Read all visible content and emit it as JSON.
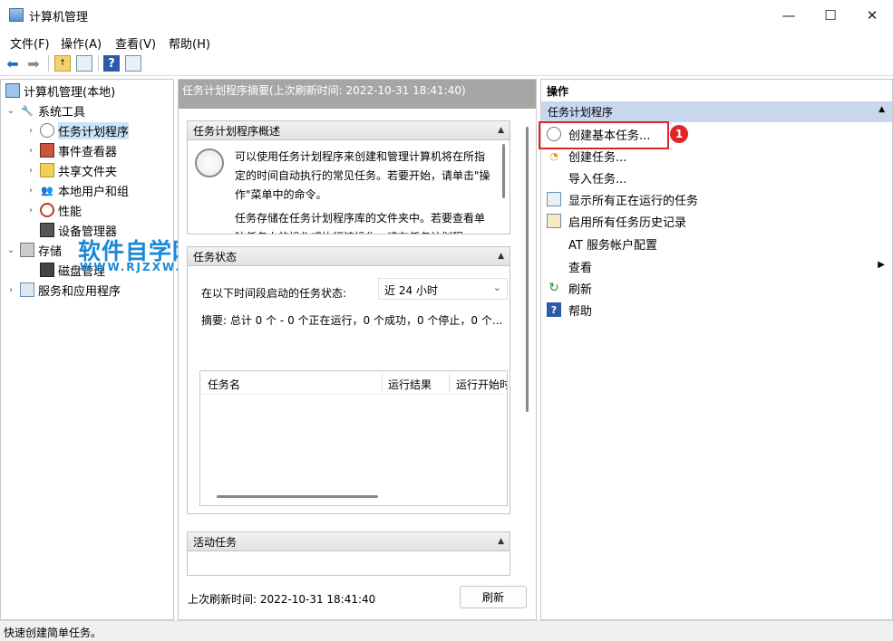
{
  "window": {
    "title": "计算机管理",
    "minimize": "—",
    "maximize": "☐",
    "close": "✕"
  },
  "menu": [
    "文件(F)",
    "操作(A)",
    "查看(V)",
    "帮助(H)"
  ],
  "tree": {
    "root": "计算机管理(本地)",
    "system_tools": "系统工具",
    "items": [
      "任务计划程序",
      "事件查看器",
      "共享文件夹",
      "本地用户和组",
      "性能",
      "设备管理器"
    ],
    "storage": "存储",
    "disk": "磁盘管理",
    "services": "服务和应用程序"
  },
  "watermark": {
    "main": "软件自学网",
    "sub": "WWW.RJZXW.COM"
  },
  "center": {
    "header": "任务计划程序摘要(上次刷新时间: 2022-10-31 18:41:40)",
    "overview_title": "任务计划程序概述",
    "overview_p1": "可以使用任务计划程序来创建和管理计算机将在所指定的时间自动执行的常见任务。若要开始，请单击\"操作\"菜单中的命令。",
    "overview_p2": "任务存储在任务计划程序库的文件夹中。若要查看单独任务上的操作或执行该操作，请在任务计划程",
    "status_title": "任务状态",
    "status_label": "在以下时间段启动的任务状态:",
    "status_select": "近 24 小时",
    "summary": "摘要: 总计 0 个 - 0 个正在运行，0 个成功，0 个停止，0 个...",
    "columns": [
      "任务名",
      "运行结果",
      "运行开始时"
    ],
    "active_title": "活动任务",
    "last_refresh": "上次刷新时间: 2022-10-31 18:41:40",
    "refresh_button": "刷新"
  },
  "actions": {
    "header": "操作",
    "group": "任务计划程序",
    "items": [
      "创建基本任务...",
      "创建任务...",
      "导入任务...",
      "显示所有正在运行的任务",
      "启用所有任务历史记录",
      "AT 服务帐户配置",
      "查看",
      "刷新",
      "帮助"
    ],
    "callout": "1"
  },
  "status_bar": "快速创建简单任务。",
  "colors": {
    "accent": "#0078d7",
    "highlight_border": "#e0242a",
    "selected_bg": "#cce4f7",
    "group_header": "#c6d7ee"
  }
}
